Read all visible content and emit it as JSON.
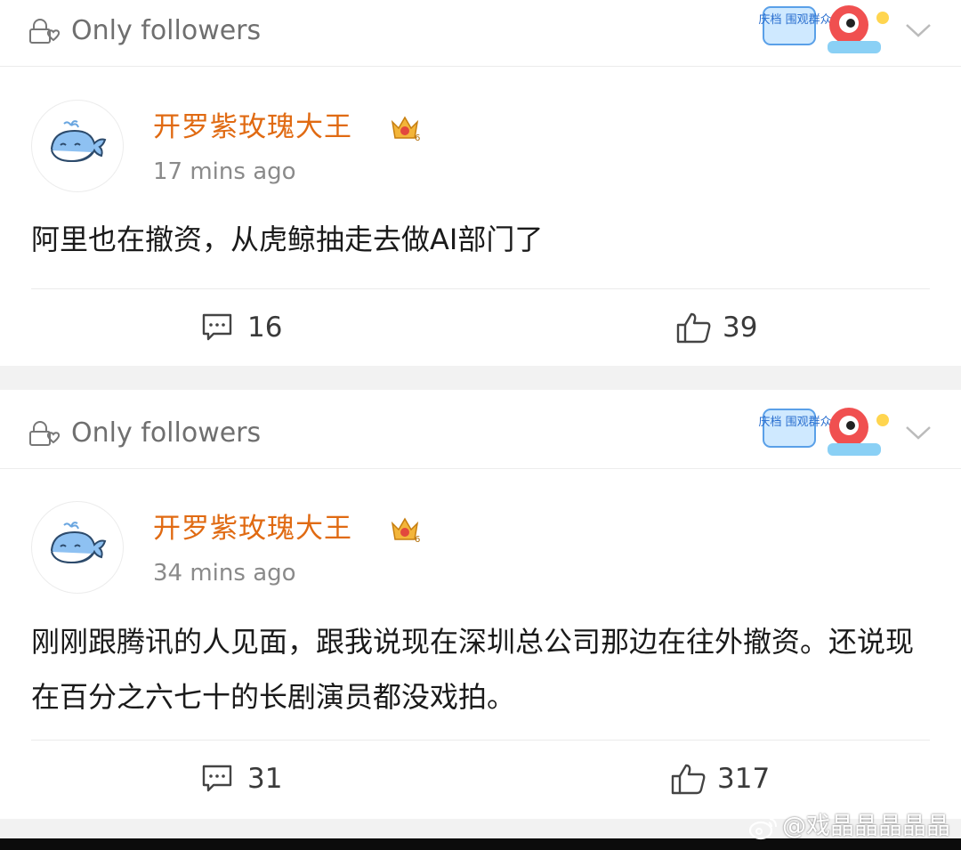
{
  "posts": [
    {
      "visibility": "Only followers",
      "username": "开罗紫玫瑰大王",
      "time": "17 mins ago",
      "content": "阿里也在撤资，从虎鲸抽走去做AI部门了",
      "comments": "16",
      "likes": "39"
    },
    {
      "visibility": "Only followers",
      "username": "开罗紫玫瑰大王",
      "time": "34 mins ago",
      "content": "刚刚跟腾讯的人见面，跟我说现在深圳总公司那边在往外撤资。还说现在百分之六七十的长剧演员都没戏拍。",
      "comments": "31",
      "likes": "317"
    }
  ],
  "badge_text": "国庆档 围观群众",
  "watermark": "@戏晶晶晶晶晶",
  "icons": {
    "visibility": "lock-heart-icon",
    "avatar": "whale-avatar-icon",
    "vip": "crown-badge-icon",
    "comment": "comment-icon",
    "like": "thumbs-up-icon",
    "expand": "chevron-down-icon"
  },
  "colors": {
    "username": "#e06a12",
    "muted": "#8a8a8a",
    "separator": "#f2f2f2"
  }
}
